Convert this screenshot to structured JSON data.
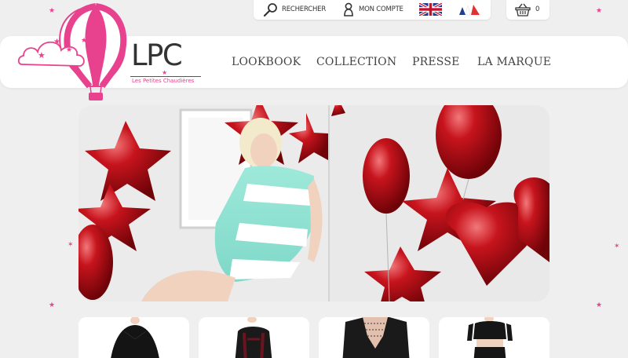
{
  "brand": {
    "name": "LPC",
    "tagline": "Les Petites Chaudières",
    "pink": "#e8428f"
  },
  "utility": {
    "search_label": "RECHERCHER",
    "account_label": "MON COMPTE",
    "languages": [
      "en",
      "fr"
    ],
    "cart_count": "0"
  },
  "nav": {
    "items": [
      {
        "label": "LOOKBOOK"
      },
      {
        "label": "COLLECTION"
      },
      {
        "label": "PRESSE"
      },
      {
        "label": "LA MARQUE"
      }
    ]
  },
  "hero": {
    "slides_visible": 2
  },
  "products": [
    {
      "icon": "black-dress"
    },
    {
      "icon": "burgundy-velvet-top"
    },
    {
      "icon": "lace-top"
    },
    {
      "icon": "crop-top-outfit"
    }
  ]
}
